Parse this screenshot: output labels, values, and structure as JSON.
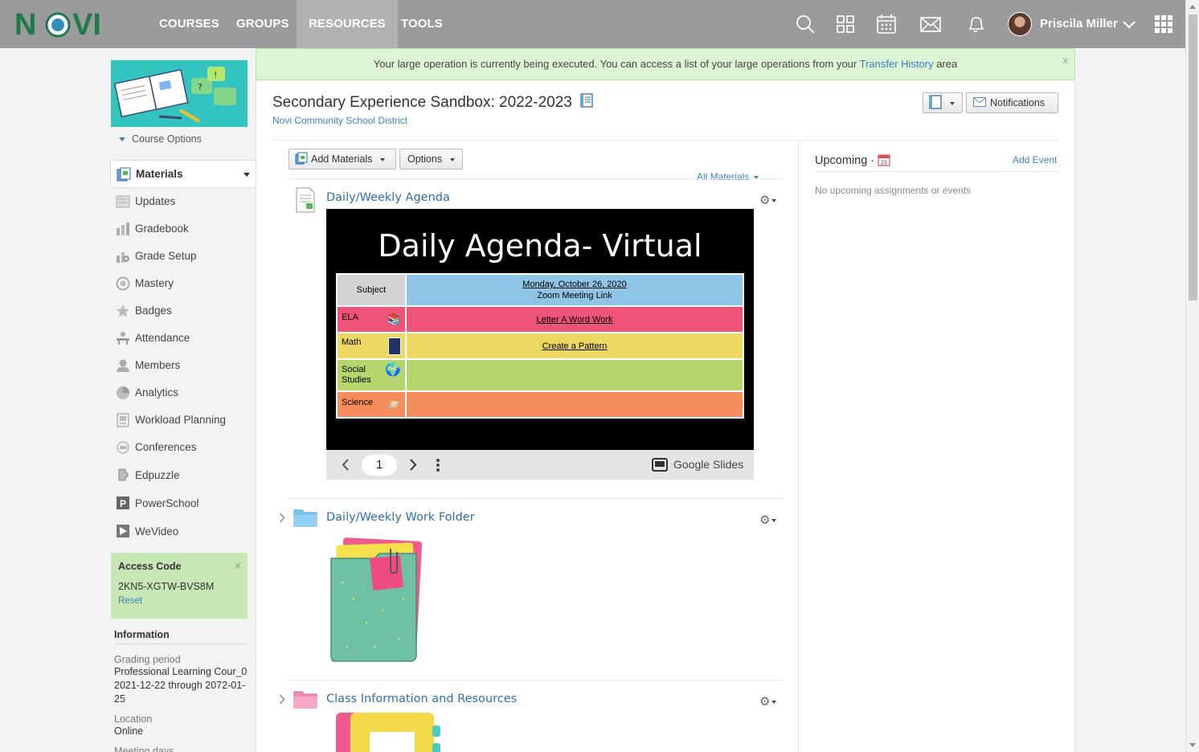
{
  "nav": {
    "logo_text": "NOVI",
    "items": [
      {
        "label": "COURSES"
      },
      {
        "label": "GROUPS"
      },
      {
        "label": "RESOURCES"
      },
      {
        "label": "TOOLS"
      }
    ],
    "user_name": "Priscila Miller"
  },
  "alert": {
    "text_before": "Your large operation is currently being executed. You can access a list of your large operations from your ",
    "link": "Transfer History",
    "text_after": " area",
    "close": "x"
  },
  "course": {
    "title": "Secondary Experience Sandbox: 2022-2023",
    "district": "Novi Community School District",
    "notifications_label": "Notifications"
  },
  "sidebar": {
    "course_options": "Course Options",
    "items": [
      {
        "label": "Materials"
      },
      {
        "label": "Updates"
      },
      {
        "label": "Gradebook"
      },
      {
        "label": "Grade Setup"
      },
      {
        "label": "Mastery"
      },
      {
        "label": "Badges"
      },
      {
        "label": "Attendance"
      },
      {
        "label": "Members"
      },
      {
        "label": "Analytics"
      },
      {
        "label": "Workload Planning"
      },
      {
        "label": "Conferences"
      },
      {
        "label": "Edpuzzle"
      },
      {
        "label": "PowerSchool"
      },
      {
        "label": "WeVideo"
      }
    ],
    "access": {
      "title": "Access Code",
      "code": "2KN5-XGTW-BVS8M",
      "reset": "Reset",
      "close": "×"
    },
    "info": {
      "heading": "Information",
      "grading_label": "Grading period",
      "grading_value": "Professional Learning Cour_0 2021-12-22 through 2072-01-25",
      "location_label": "Location",
      "location_value": "Online",
      "meeting_label": "Meeting days"
    }
  },
  "toolbar": {
    "add_materials": "Add Materials",
    "options": "Options",
    "all_materials": "All Materials"
  },
  "materials": [
    {
      "title": "Daily/Weekly Agenda"
    },
    {
      "title": "Daily/Weekly Work Folder"
    },
    {
      "title": "Class Information and Resources"
    }
  ],
  "slides": {
    "title": "Daily Agenda- Virtual",
    "page": "1",
    "provider": "Google Slides",
    "header_subject": "Subject",
    "header_date": "Monday, October 26, 2020",
    "header_link": "Zoom Meeting Link",
    "rows": [
      {
        "subject": "ELA",
        "content": "Letter A Word Work",
        "color": "#ee5478"
      },
      {
        "subject": "Math",
        "content": "Create a Pattern",
        "color": "#ecd860"
      },
      {
        "subject": "Social Studies",
        "content": "",
        "color": "#b4d66c"
      },
      {
        "subject": "Science",
        "content": "",
        "color": "#f58e5c"
      }
    ],
    "header_color": "#8ec4e6"
  },
  "upcoming": {
    "title": "Upcoming ·",
    "calendar_day": "23",
    "add_event": "Add Event",
    "empty": "No upcoming assignments or events"
  },
  "colors": {
    "nav_bg": "#9b9b9d",
    "link": "#3f7fc0",
    "alert_bg": "#dcf5d4",
    "access_bg": "#c7e7b4"
  }
}
